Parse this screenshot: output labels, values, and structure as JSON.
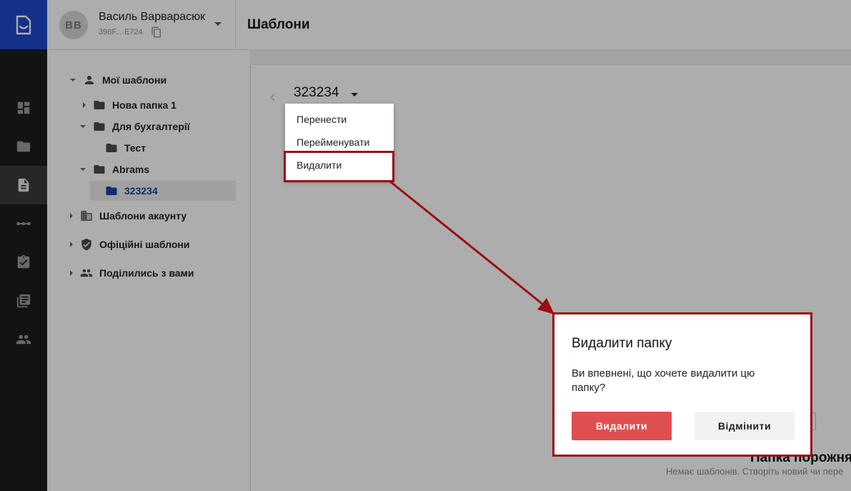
{
  "header": {
    "user_name": "Василь Варварасюк",
    "user_initials": "ВВ",
    "user_id": "398F…E724",
    "page_title": "Шаблони"
  },
  "rail": {
    "items": [
      "dashboard-icon",
      "folder-icon",
      "document-icon",
      "workflow-icon",
      "tasks-icon",
      "library-icon",
      "people-icon"
    ],
    "active_index": 2
  },
  "tree": {
    "my_templates": "Мої шаблони",
    "folder_new": "Нова папка 1",
    "folder_accounting": "Для бухгалтерії",
    "folder_test": "Тест",
    "folder_abrams": "Abrams",
    "folder_selected": "323234",
    "account_templates": "Шаблони акаунту",
    "official_templates": "Офіційні шаблони",
    "shared_with_you": "Поділились з вами"
  },
  "content": {
    "folder_title": "323234",
    "empty_title": "Папка порожня",
    "empty_subtitle": "Немає шаблонів. Створіть новий чи пере"
  },
  "menu": {
    "items": [
      "Перенести",
      "Перейменувати",
      "Видалити"
    ],
    "highlighted_index": 2
  },
  "dialog": {
    "title": "Видалити папку",
    "message": "Ви впевнені, що хочете видалити цю папку?",
    "confirm_label": "Видалити",
    "cancel_label": "Відмінити"
  },
  "colors": {
    "brand": "#1d49c9",
    "danger": "#e04f4f",
    "annotation": "#9b0e14"
  }
}
